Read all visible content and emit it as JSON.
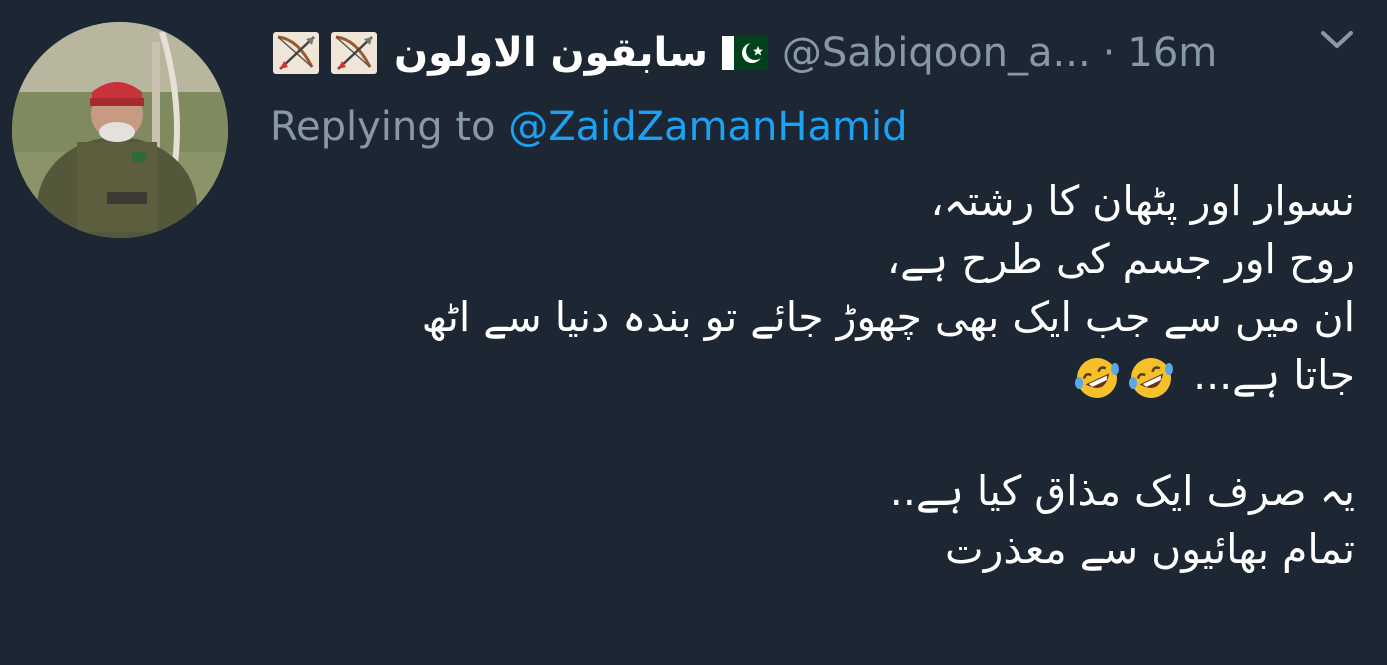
{
  "author": {
    "display_name": "سابقون الاولون",
    "handle": "@Sabiqoon_a...",
    "dot": "·",
    "time": "16m",
    "icons": [
      "bow-and-arrow-icon",
      "bow-and-arrow-icon",
      "pakistan-flag-icon"
    ]
  },
  "reply": {
    "prefix": "Replying to",
    "handle": "@ZaidZamanHamid"
  },
  "body": {
    "lines": [
      "نسوار اور پٹھان کا رشتہ،",
      "روح اور جسم کی طرح ہے،",
      "ان میں سے جب ایک بھی چھوڑ جائے تو بندہ دنیا سے اٹھ",
      "جاتا ہے...",
      "",
      "یہ صرف ایک مذاق کیا ہے..",
      "تمام بھائیوں سے معذرت"
    ],
    "emoji": [
      "rolling-on-floor-laughing-icon",
      "rolling-on-floor-laughing-icon"
    ]
  },
  "colors": {
    "background": "#1c2733",
    "text": "#ffffff",
    "muted": "#8899a6",
    "link": "#1da1f2"
  }
}
